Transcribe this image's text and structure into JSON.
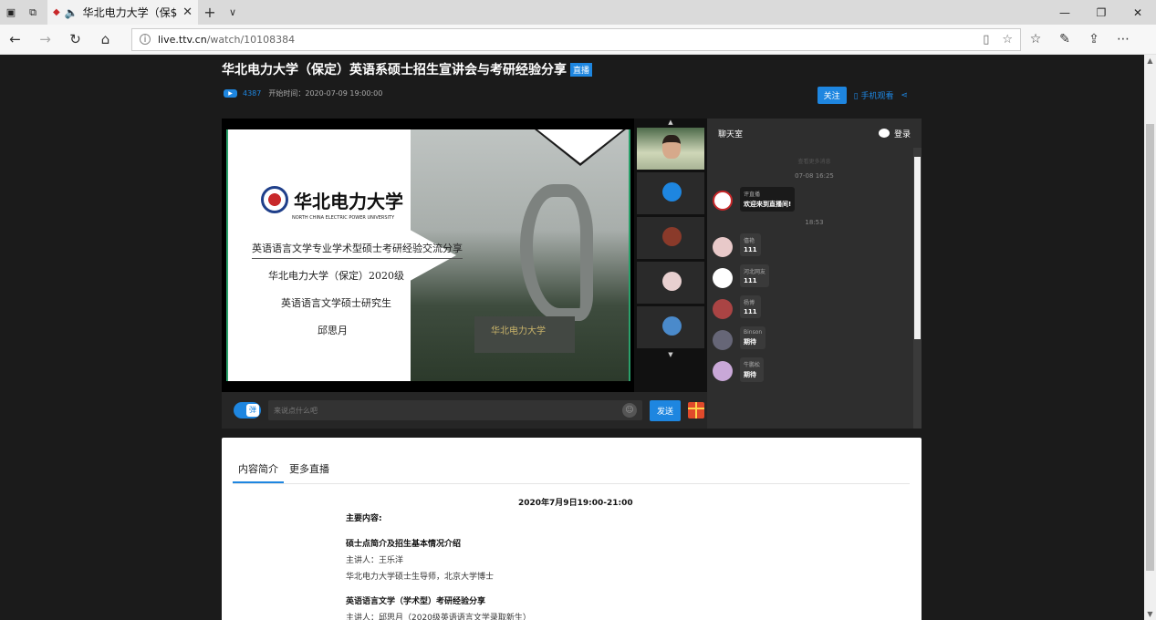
{
  "browser": {
    "tab_title": "华北电力大学（保$",
    "url_host": "live.ttv.cn",
    "url_path": "/watch/10108384"
  },
  "page": {
    "title": "华北电力大学（保定）英语系硕士招生宣讲会与考研经验分享",
    "live_badge": "直播",
    "viewer_count": "4387",
    "start_time": "开始时间：2020-07-09 19:00:00",
    "follow_label": "关注",
    "mobile_label": "手机观看"
  },
  "slide": {
    "logo_cn": "华北电力大学",
    "logo_en": "NORTH CHINA ELECTRIC POWER UNIVERSITY",
    "line1": "英语语言文学专业学术型硕士考研经验交流分享",
    "line2": "华北电力大学（保定）2020级",
    "line3": "英语语言文学硕士研究生",
    "line4": "邱思月",
    "stone_text": "华北电力大学"
  },
  "danmu": {
    "toggle_label": "弹",
    "placeholder": "来说点什么吧",
    "send_label": "发送"
  },
  "chat": {
    "title": "聊天室",
    "login_label": "登录",
    "more_label": "查看更多消息",
    "time1": "07-08 16:25",
    "time2": "18:53",
    "messages": [
      {
        "name": "评直播",
        "text": "欢迎来到直播间!",
        "color": "#ffffff"
      },
      {
        "name": "僖艳",
        "text": "111",
        "color": "#e8c9c9"
      },
      {
        "name": "河北网友",
        "text": "111",
        "color": "#ffffff"
      },
      {
        "name": "杨博",
        "text": "111",
        "color": "#a44"
      },
      {
        "name": "Binson",
        "text": "期待",
        "color": "#667"
      },
      {
        "name": "牛鹏松",
        "text": "期待",
        "color": "#c9a8d8"
      }
    ]
  },
  "content": {
    "tab_intro": "内容简介",
    "tab_more": "更多直播",
    "date": "2020年7月9日19:00-21:00",
    "main_label": "主要内容:",
    "s1_title": "硕士点简介及招生基本情况介绍",
    "s1_speaker": "主讲人：王乐洋",
    "s1_desc": "华北电力大学硕士生导师，北京大学博士",
    "s2_title": "英语语言文学（学术型）考研经验分享",
    "s2_speaker": "主讲人：邱思月（2020级英语语言文学录取新生）"
  },
  "colors": {
    "accent": "#1e86e0",
    "page_bg": "#1b1b1b"
  }
}
